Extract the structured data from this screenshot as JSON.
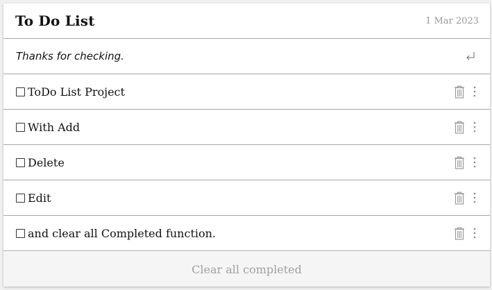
{
  "header": {
    "title": "To Do List",
    "date": "1 Mar 2023"
  },
  "new_todo": {
    "value": "Thanks for checking.",
    "placeholder": "",
    "submit_icon": "enter-icon"
  },
  "todos": [
    {
      "text": "ToDo List Project",
      "completed": false
    },
    {
      "text": "With Add",
      "completed": false
    },
    {
      "text": "Delete",
      "completed": false
    },
    {
      "text": "Edit",
      "completed": false
    },
    {
      "text": "and clear all Completed function.",
      "completed": false
    }
  ],
  "item_icons": {
    "delete": "trash-icon",
    "menu": "more-vertical-icon"
  },
  "footer": {
    "clear_label": "Clear all completed"
  },
  "colors": {
    "background": "#f0f0f0",
    "card": "#ffffff",
    "divider": "#a6a6a6",
    "muted": "#999999",
    "footer_bg": "#f5f5f5"
  }
}
